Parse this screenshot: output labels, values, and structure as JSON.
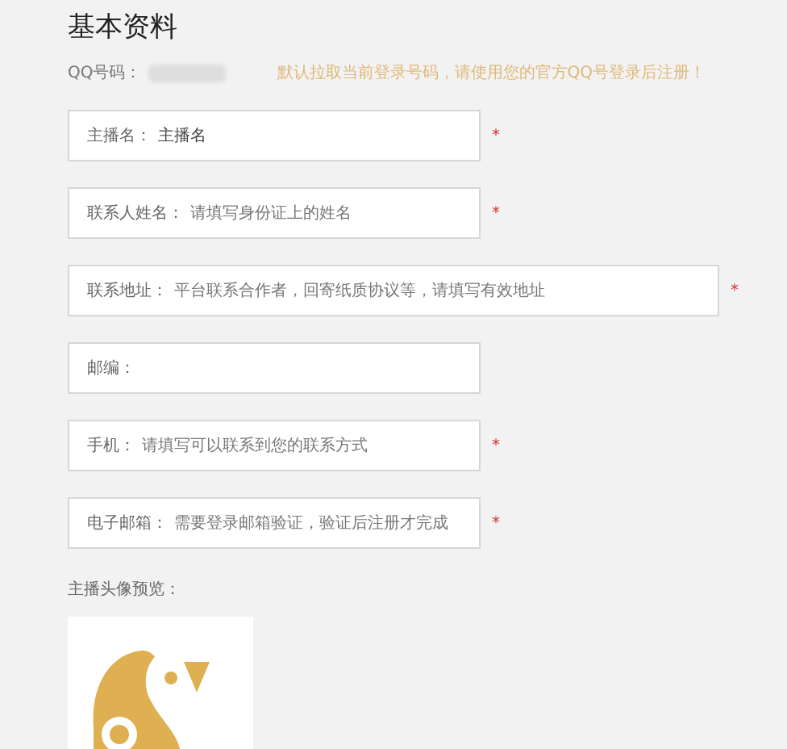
{
  "title": "基本资料",
  "qq": {
    "label": "QQ号码：",
    "hint": "默认拉取当前登录号码，请使用您的官方QQ号登录后注册！"
  },
  "fields": [
    {
      "label": "主播名：",
      "value": "主播名",
      "mark": "*",
      "wide": false
    },
    {
      "label": "联系人姓名：",
      "placeholder": "请填写身份证上的姓名",
      "mark": "*",
      "wide": false
    },
    {
      "label": "联系地址：",
      "placeholder": "平台联系合作者，回寄纸质协议等，请填写有效地址",
      "mark": "*",
      "wide": true
    },
    {
      "label": "邮编：",
      "wide": false
    },
    {
      "label": "手机：",
      "placeholder": "请填写可以联系到您的联系方式",
      "mark": "*",
      "wide": false
    },
    {
      "label": "电子邮箱：",
      "placeholder": "需要登录邮箱验证，验证后注册才完成",
      "mark": "*",
      "wide": false
    }
  ],
  "avatar": {
    "label": "主播头像预览："
  }
}
